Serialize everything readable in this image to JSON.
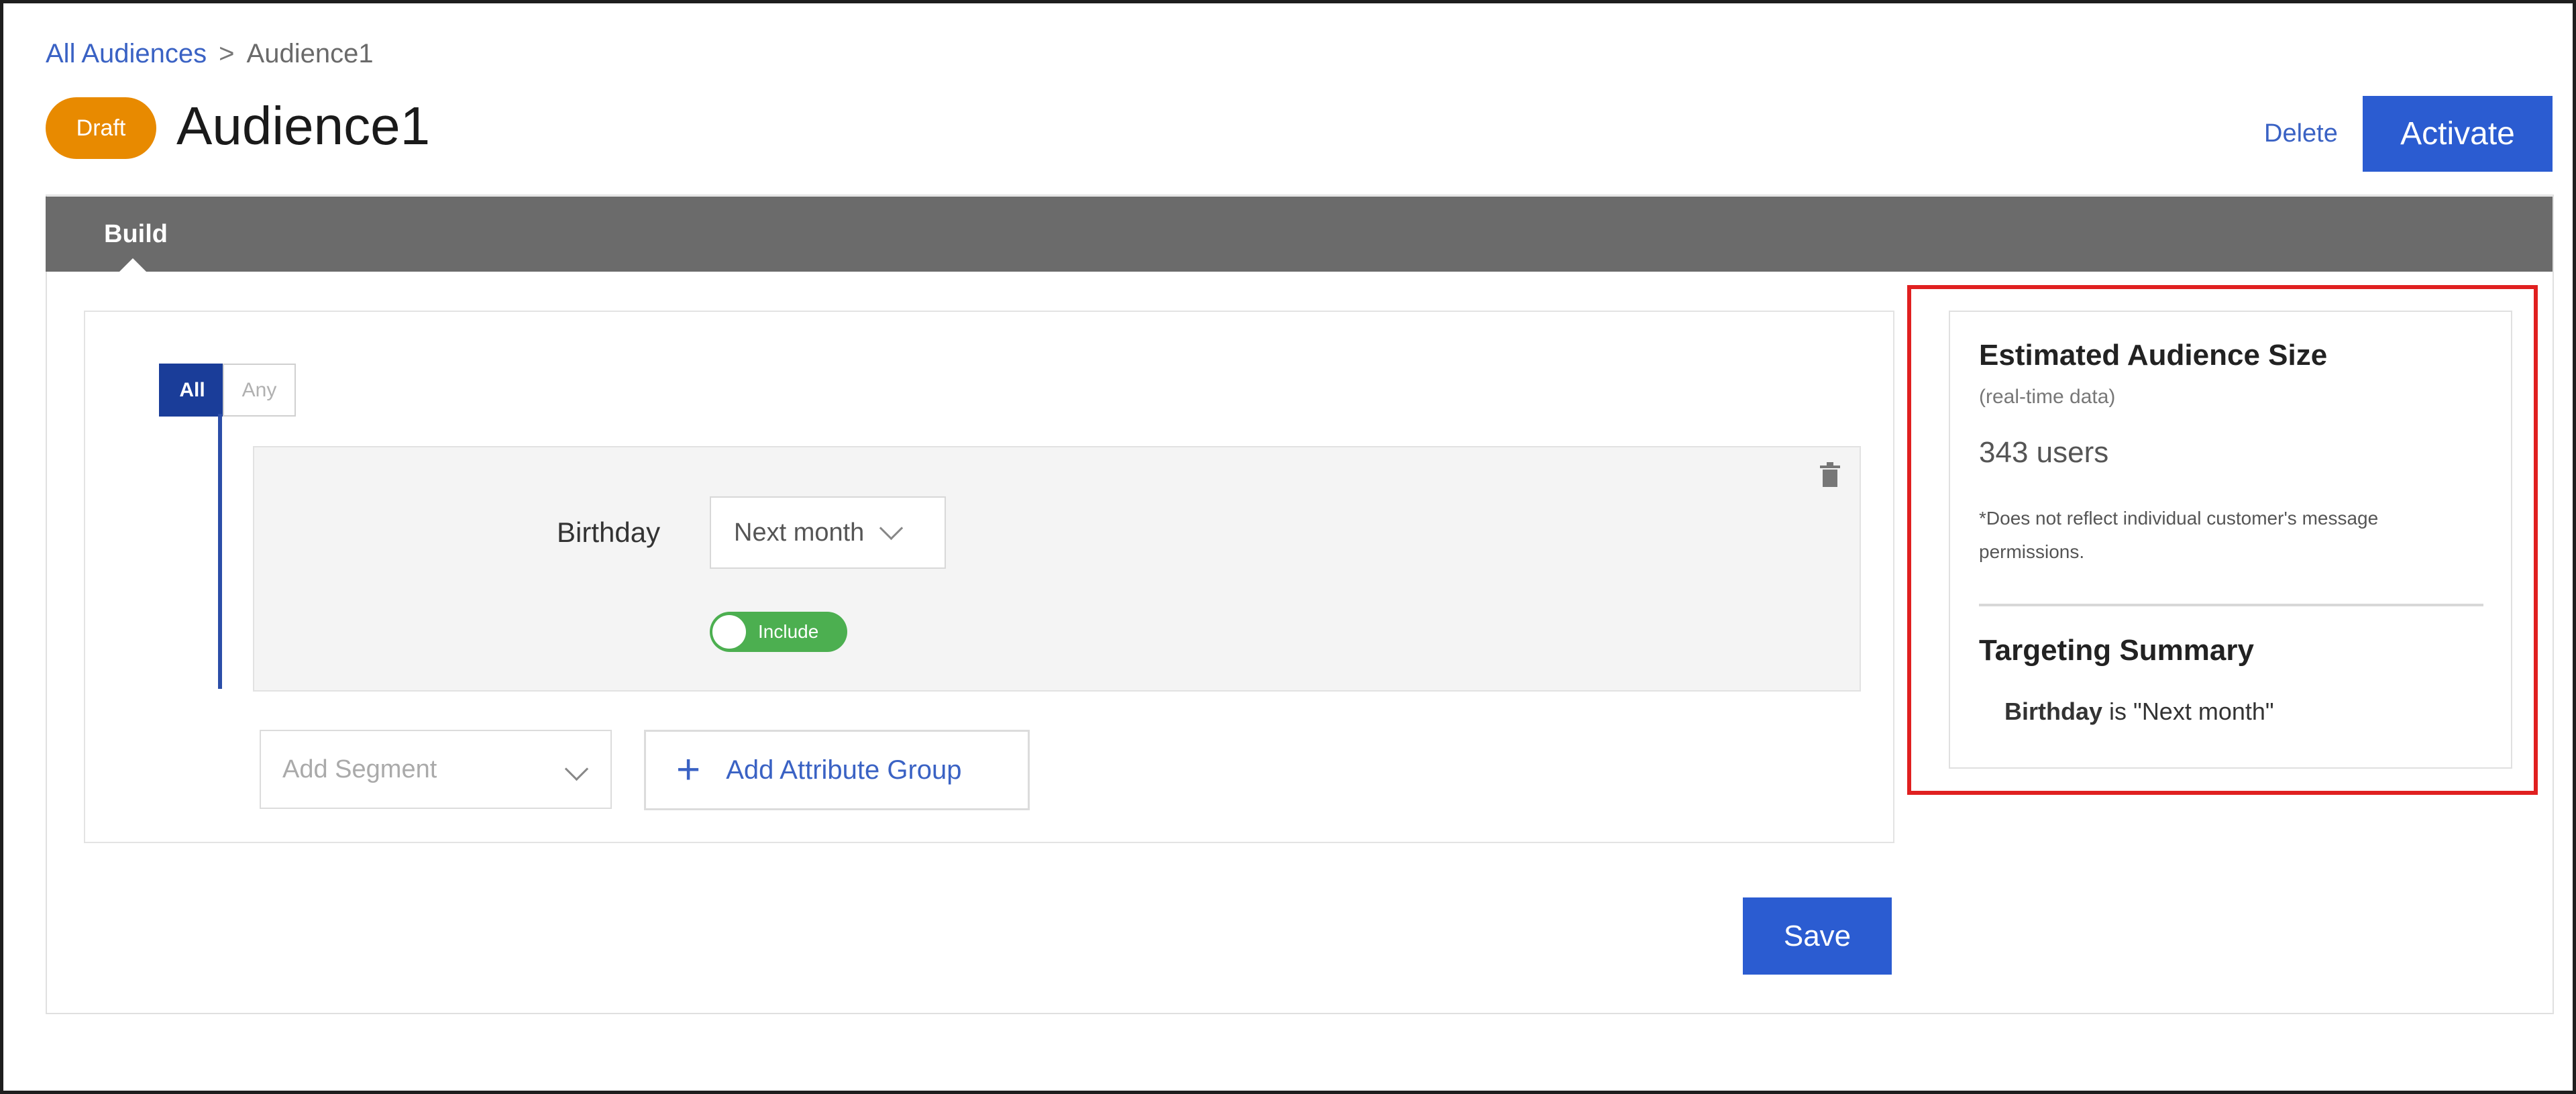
{
  "breadcrumb": {
    "root": "All Audiences",
    "separator": ">",
    "current": "Audience1"
  },
  "header": {
    "status_badge": "Draft",
    "title": "Audience1",
    "delete_label": "Delete",
    "activate_label": "Activate"
  },
  "tabs": [
    {
      "label": "Build",
      "active": true
    }
  ],
  "builder": {
    "match_all": "All",
    "match_any": "Any",
    "condition": {
      "attribute": "Birthday",
      "value": "Next month",
      "include_label": "Include",
      "include_on": true
    },
    "add_segment_placeholder": "Add Segment",
    "add_attribute_group_label": "Add Attribute Group"
  },
  "save_label": "Save",
  "summary": {
    "est_title": "Estimated Audience Size",
    "realtime": "(real-time data)",
    "count": "343 users",
    "disclaimer": "*Does not reflect individual customer's message permissions.",
    "targeting_title": "Targeting Summary",
    "targeting_attr": "Birthday",
    "targeting_rest": " is \"Next month\""
  },
  "colors": {
    "accent": "#2b5cd1",
    "draft": "#e88a00",
    "include": "#4caf50",
    "highlight": "#e02020",
    "tab_bar": "#6b6b6b"
  },
  "icons": {
    "trash": "trash-icon",
    "plus": "plus-icon",
    "chevron": "chevron-down-icon"
  }
}
